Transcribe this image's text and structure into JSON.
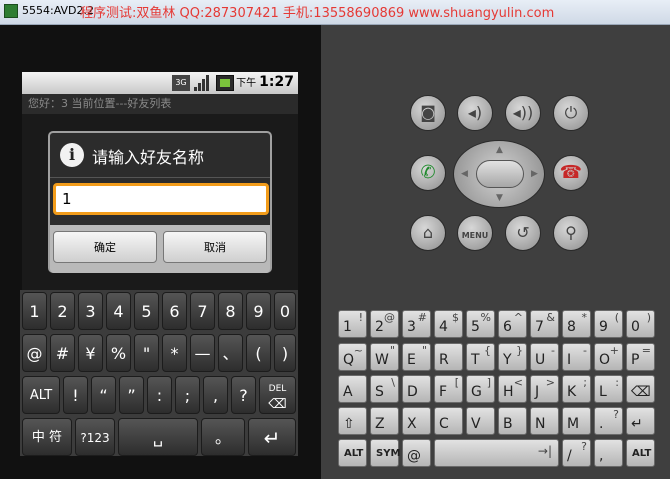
{
  "window": {
    "title": "5554:AVD2.2",
    "watermark": "程序测试:双鱼林 QQ:287307421 手机:13558690869 www.shuangyulin.com"
  },
  "status_bar": {
    "network": "3G",
    "ampm": "下午",
    "time": "1:27"
  },
  "app_bar": {
    "text": "您好：3   当前位置---好友列表"
  },
  "dialog": {
    "title": "请输入好友名称",
    "input_value": "1",
    "ok_label": "确定",
    "cancel_label": "取消"
  },
  "soft_keyboard": {
    "row1": [
      "1",
      "2",
      "3",
      "4",
      "5",
      "6",
      "7",
      "8",
      "9",
      "0"
    ],
    "row2": [
      "@",
      "#",
      "¥",
      "%",
      "\"",
      "*",
      "—",
      "、",
      "(",
      ")"
    ],
    "row3": [
      "ALT",
      "!",
      "“",
      "”",
      ":",
      ";",
      ",",
      "?",
      "DEL"
    ],
    "row4": [
      "中 符",
      "?123",
      "␣",
      "。",
      "↵"
    ]
  },
  "hw_buttons": {
    "menu": "MENU"
  },
  "hw_keyboard": {
    "row1": [
      [
        "1",
        "!"
      ],
      [
        "2",
        "@"
      ],
      [
        "3",
        "#"
      ],
      [
        "4",
        "$"
      ],
      [
        "5",
        "%"
      ],
      [
        "6",
        "^"
      ],
      [
        "7",
        "&"
      ],
      [
        "8",
        "*"
      ],
      [
        "9",
        "("
      ],
      [
        "0",
        ")"
      ]
    ],
    "row2": [
      [
        "Q",
        "~"
      ],
      [
        "W",
        "\""
      ],
      [
        "E",
        "\""
      ],
      [
        "R",
        ""
      ],
      [
        "T",
        "{"
      ],
      [
        "Y",
        "}"
      ],
      [
        "U",
        "-"
      ],
      [
        "I",
        "-"
      ],
      [
        "O",
        "+"
      ],
      [
        "P",
        "="
      ]
    ],
    "row3": [
      [
        "A",
        ""
      ],
      [
        "S",
        "\\"
      ],
      [
        "D",
        ""
      ],
      [
        "F",
        "["
      ],
      [
        "G",
        "]"
      ],
      [
        "H",
        "<"
      ],
      [
        "J",
        ">"
      ],
      [
        "K",
        ";"
      ],
      [
        "L",
        ":"
      ]
    ],
    "row4": [
      [
        "Z",
        ""
      ],
      [
        "X",
        ""
      ],
      [
        "C",
        ""
      ],
      [
        "V",
        ""
      ],
      [
        "B",
        ""
      ],
      [
        "N",
        ""
      ],
      [
        "M",
        ""
      ],
      [
        ".",
        "?"
      ]
    ],
    "row5": [
      [
        "ALT",
        ""
      ],
      [
        "SYM",
        ""
      ],
      [
        "@",
        ""
      ],
      [
        "",
        ""
      ],
      [
        "→|",
        ""
      ],
      [
        "/",
        "?"
      ],
      [
        ",",
        ""
      ],
      [
        "ALT",
        ""
      ]
    ]
  }
}
